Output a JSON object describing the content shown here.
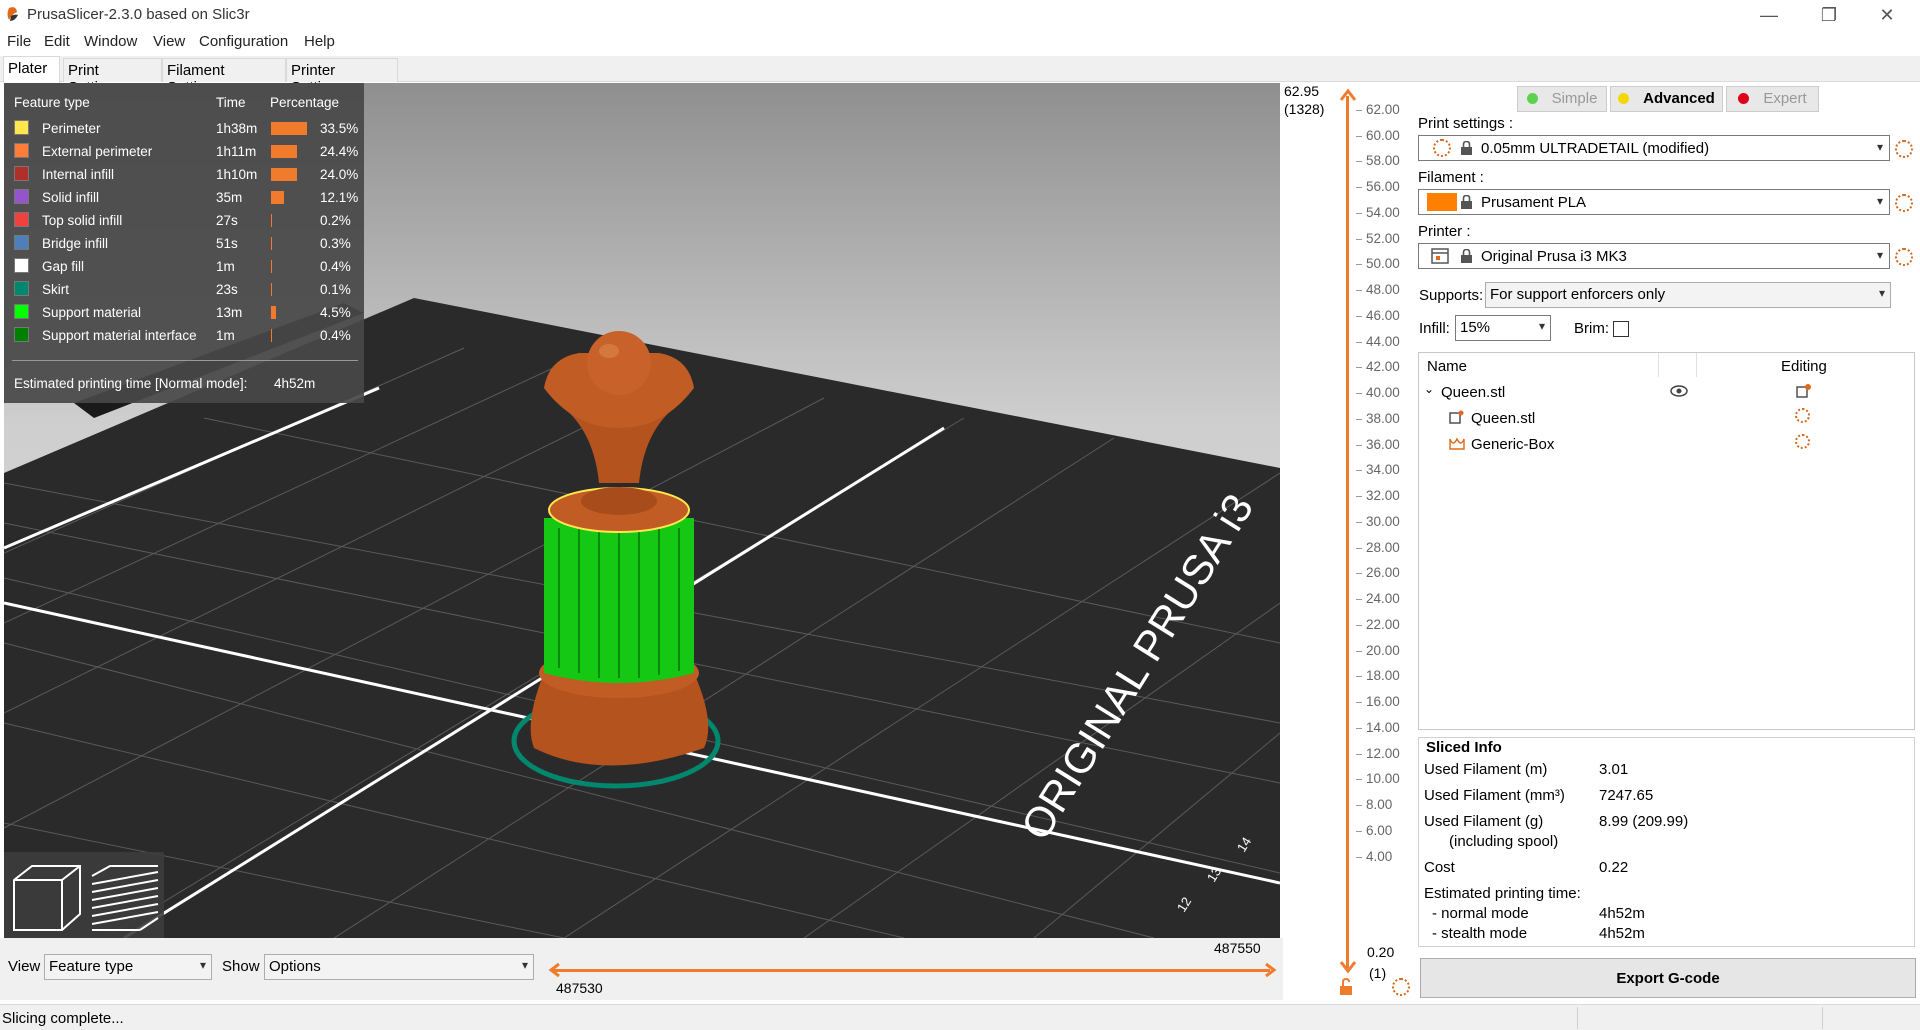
{
  "window": {
    "title": "PrusaSlicer-2.3.0 based on Slic3r",
    "minimize": "—",
    "maximize": "❐",
    "close": "✕"
  },
  "menu": [
    "File",
    "Edit",
    "Window",
    "View",
    "Configuration",
    "Help"
  ],
  "tabs": [
    "Plater",
    "Print Settings",
    "Filament Settings",
    "Printer Settings"
  ],
  "legend": {
    "headers": {
      "feature": "Feature type",
      "time": "Time",
      "percentage": "Percentage"
    },
    "rows": [
      {
        "name": "Perimeter",
        "time": "1h38m",
        "pct": "33.5%",
        "value": 33.5,
        "color": "#ffe64d"
      },
      {
        "name": "External perimeter",
        "time": "1h11m",
        "pct": "24.4%",
        "value": 24.4,
        "color": "#ff7d38"
      },
      {
        "name": "Internal infill",
        "time": "1h10m",
        "pct": "24.0%",
        "value": 24.0,
        "color": "#b03029"
      },
      {
        "name": "Solid infill",
        "time": "35m",
        "pct": "12.1%",
        "value": 12.1,
        "color": "#9654cc"
      },
      {
        "name": "Top solid infill",
        "time": "27s",
        "pct": "0.2%",
        "value": 0.2,
        "color": "#f04040"
      },
      {
        "name": "Bridge infill",
        "time": "51s",
        "pct": "0.3%",
        "value": 0.3,
        "color": "#4d80ba"
      },
      {
        "name": "Gap fill",
        "time": "1m",
        "pct": "0.4%",
        "value": 0.4,
        "color": "#ffffff"
      },
      {
        "name": "Skirt",
        "time": "23s",
        "pct": "0.1%",
        "value": 0.1,
        "color": "#00876e"
      },
      {
        "name": "Support material",
        "time": "13m",
        "pct": "4.5%",
        "value": 4.5,
        "color": "#00ff00"
      },
      {
        "name": "Support material interface",
        "time": "1m",
        "pct": "0.4%",
        "value": 0.4,
        "color": "#008000"
      }
    ],
    "estimated_label": "Estimated printing time [Normal mode]:",
    "estimated_value": "4h52m"
  },
  "bed_text": "ORIGINAL PRUSA i3",
  "bed_numbers": [
    "14",
    "13",
    "12"
  ],
  "bottom": {
    "view_label": "View",
    "view_value": "Feature type",
    "show_label": "Show",
    "show_value": "Options",
    "slider_top": "487550",
    "slider_bottom": "487530"
  },
  "vslider": {
    "top_value": "62.95",
    "top_layer": "(1328)",
    "bottom_value": "0.20",
    "bottom_layer": "(1)",
    "ticks": [
      "62.00",
      "60.00",
      "58.00",
      "56.00",
      "54.00",
      "52.00",
      "50.00",
      "48.00",
      "46.00",
      "44.00",
      "42.00",
      "40.00",
      "38.00",
      "36.00",
      "34.00",
      "32.00",
      "30.00",
      "28.00",
      "26.00",
      "24.00",
      "22.00",
      "20.00",
      "18.00",
      "16.00",
      "14.00",
      "12.00",
      "10.00",
      "8.00",
      "6.00",
      "4.00"
    ]
  },
  "modes": {
    "simple": "Simple",
    "advanced": "Advanced",
    "expert": "Expert",
    "simple_color": "#5ed151",
    "advanced_color": "#f5d800",
    "expert_color": "#e0001a"
  },
  "print_settings": {
    "label": "Print settings :",
    "value": "0.05mm ULTRADETAIL (modified)"
  },
  "filament": {
    "label": "Filament :",
    "value": "Prusament PLA",
    "color": "#ff8000"
  },
  "printer": {
    "label": "Printer :",
    "value": "Original Prusa i3 MK3"
  },
  "supports": {
    "label": "Supports:",
    "value": "For support enforcers only"
  },
  "infill": {
    "label": "Infill:",
    "value": "15%"
  },
  "brim": {
    "label": "Brim:"
  },
  "objects": {
    "name_header": "Name",
    "editing_header": "Editing",
    "items": [
      {
        "name": "Queen.stl",
        "level": 0
      },
      {
        "name": "Queen.stl",
        "level": 1
      },
      {
        "name": "Generic-Box",
        "level": 1
      }
    ]
  },
  "sliced_info": {
    "title": "Sliced Info",
    "used_m_label": "Used Filament (m)",
    "used_m": "3.01",
    "used_mm3_label": "Used Filament (mm³)",
    "used_mm3": "7247.65",
    "used_g_label": "Used Filament (g)",
    "used_g_sub": "(including spool)",
    "used_g": "8.99 (209.99)",
    "cost_label": "Cost",
    "cost": "0.22",
    "est_label": "Estimated printing time:",
    "normal_label": "- normal mode",
    "normal": "4h52m",
    "stealth_label": "- stealth mode",
    "stealth": "4h52m"
  },
  "export_label": "Export G-code",
  "status": "Slicing complete..."
}
